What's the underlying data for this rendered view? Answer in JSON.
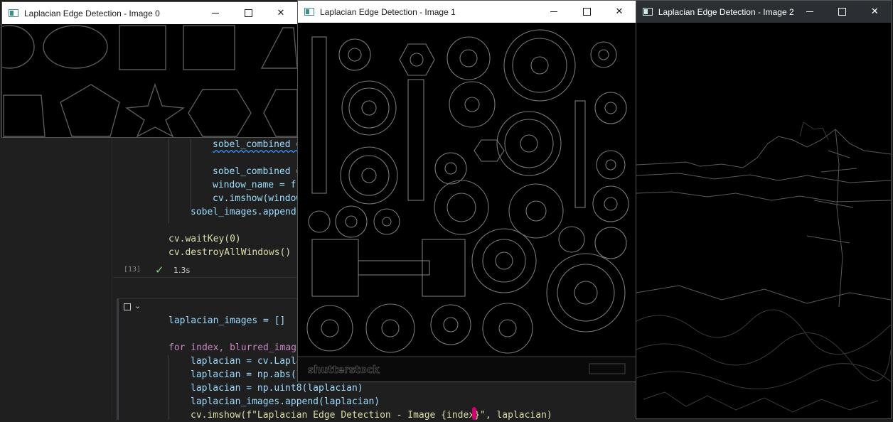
{
  "editor": {
    "lines_top": [
      {
        "indent": 299,
        "text": "sobel_combined =",
        "squiggle": true
      },
      {
        "indent": 299,
        "text": "sobel_combined ="
      },
      {
        "indent": 299,
        "text": "window_name = f\""
      },
      {
        "indent": 299,
        "text": "cv.imshow(window"
      },
      {
        "indent": 268,
        "text": "sobel_images.append("
      }
    ],
    "wait_key": "cv.waitKey(0)",
    "destroy": "cv.destroyAllWindows()",
    "exec_count": "[13]",
    "exec_time": "1.3s",
    "cell2": {
      "line1": "laplacian_images = []",
      "line2": "for index, blurred_image",
      "line3": "laplacian = cv.Lapla",
      "line4": "laplacian = np.abs(l",
      "line5": "laplacian = np.uint8(laplacian)",
      "line6": "laplacian_images.append(laplacian)",
      "line7": "cv.imshow(f\"Laplacian Edge Detection - Image {index}\", laplacian)"
    }
  },
  "windows": [
    {
      "title": "Laplacian Edge Detection - Image 0",
      "theme": "light"
    },
    {
      "title": "Laplacian Edge Detection - Image 1",
      "theme": "light",
      "watermark": "shutterstock"
    },
    {
      "title": "Laplacian Edge Detection - Image 2",
      "theme": "dark"
    }
  ],
  "icons": {
    "minimize": "minimize-icon",
    "maximize": "maximize-icon",
    "close": "close-icon",
    "app": "opencv-window-icon"
  }
}
